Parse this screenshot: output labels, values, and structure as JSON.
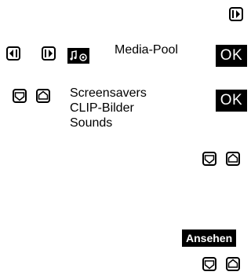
{
  "header": {
    "icon": "menu-right-key-icon"
  },
  "media_pool": {
    "icon": "media-pool-icon",
    "title": "Media-Pool",
    "softkey": "OK",
    "keys": [
      "menu-left-key-icon",
      "menu-right-key-icon"
    ]
  },
  "submenu": {
    "keys": [
      "nav-down-key-icon",
      "nav-up-key-icon"
    ],
    "items": [
      "Screensavers",
      "CLIP-Bilder",
      "Sounds"
    ],
    "softkey": "OK"
  },
  "scroll_step": {
    "keys": [
      "nav-down-key-icon",
      "nav-up-key-icon"
    ]
  },
  "view_step": {
    "softkey": "Ansehen",
    "keys": [
      "nav-down-key-icon",
      "nav-up-key-icon"
    ]
  }
}
